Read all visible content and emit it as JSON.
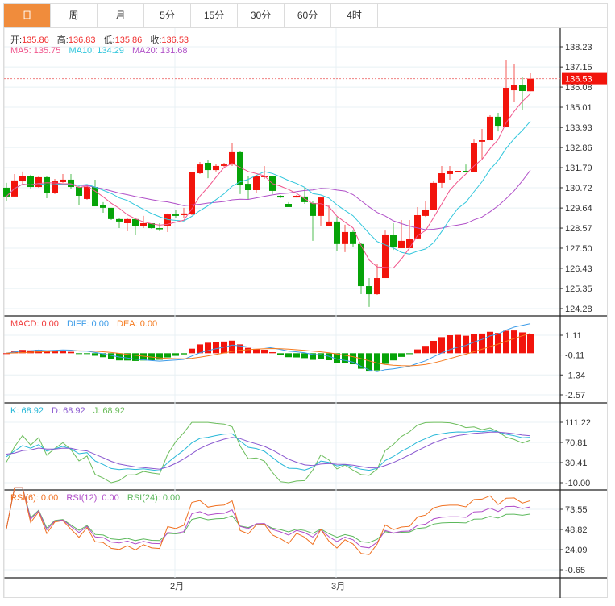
{
  "tabs": [
    {
      "label": "日",
      "active": true
    },
    {
      "label": "周"
    },
    {
      "label": "月"
    },
    {
      "label": "5分"
    },
    {
      "label": "15分"
    },
    {
      "label": "30分"
    },
    {
      "label": "60分"
    },
    {
      "label": "4时"
    }
  ],
  "ohlc_legend": {
    "open_label": "开:",
    "open": "135.86",
    "high_label": "高:",
    "high": "136.83",
    "low_label": "低:",
    "low": "135.86",
    "close_label": "收:",
    "close": "136.53"
  },
  "ma_legend": {
    "ma5": "MA5: 135.75",
    "ma10": "MA10: 134.29",
    "ma20": "MA20: 131.68"
  },
  "macd_legend": {
    "macd": "MACD: 0.00",
    "diff": "DIFF: 0.00",
    "dea": "DEA: 0.00"
  },
  "kdj_legend": {
    "k": "K: 68.92",
    "d": "D: 68.92",
    "j": "J: 68.92"
  },
  "rsi_legend": {
    "rsi6": "RSI(6): 0.00",
    "rsi12": "RSI(12): 0.00",
    "rsi24": "RSI(24): 0.00"
  },
  "last_price": "136.53",
  "colors": {
    "up": "#f2140c",
    "down": "#06a308",
    "ma5": "#f0558c",
    "ma10": "#30c6dc",
    "ma20": "#b050c8",
    "diff": "#3d9ce8",
    "dea": "#f57a1e",
    "k": "#28b8d8",
    "d": "#8a58d0",
    "j": "#6cbd5c",
    "rsi6": "#f07020",
    "rsi12": "#b04cc8",
    "rsi24": "#5cb85c",
    "accent": "#f08c3c"
  },
  "axes": {
    "price_ticks": [
      "138.23",
      "137.15",
      "136.08",
      "135.01",
      "133.93",
      "132.86",
      "131.79",
      "130.72",
      "129.64",
      "128.57",
      "127.50",
      "126.43",
      "125.35",
      "124.28"
    ],
    "macd_ticks": [
      "1.11",
      "-0.11",
      "-1.34",
      "-2.57"
    ],
    "kdj_ticks": [
      "111.22",
      "70.81",
      "30.41",
      "-10.00"
    ],
    "rsi_ticks": [
      "73.55",
      "48.82",
      "24.09",
      "-0.65"
    ],
    "date_labels": [
      {
        "label": "2月",
        "index": 21
      },
      {
        "label": "3月",
        "index": 41
      }
    ]
  },
  "chart_data": {
    "type": "candlestick",
    "ylim": [
      124.28,
      138.23
    ],
    "candles": [
      [
        130.72,
        130.25,
        130.98,
        129.99
      ],
      [
        130.25,
        131.11,
        131.45,
        130.25
      ],
      [
        131.06,
        131.36,
        131.58,
        130.85
      ],
      [
        131.36,
        130.76,
        131.41,
        130.68
      ],
      [
        130.76,
        131.28,
        131.32,
        130.72
      ],
      [
        131.28,
        130.42,
        131.36,
        130.16
      ],
      [
        130.42,
        131.06,
        131.19,
        130.38
      ],
      [
        131.02,
        131.15,
        131.45,
        130.98
      ],
      [
        131.15,
        130.76,
        131.45,
        130.63
      ],
      [
        130.76,
        130.29,
        130.81,
        129.78
      ],
      [
        130.12,
        130.76,
        130.85,
        130.08
      ],
      [
        130.76,
        129.73,
        131.15,
        129.73
      ],
      [
        129.78,
        129.65,
        129.95,
        129.39
      ],
      [
        129.65,
        129.05,
        129.65,
        129.0
      ],
      [
        129.05,
        128.92,
        129.13,
        128.57
      ],
      [
        128.83,
        129.05,
        129.13,
        128.4
      ],
      [
        129.05,
        128.66,
        129.13,
        128.23
      ],
      [
        128.66,
        128.83,
        129.22,
        128.57
      ],
      [
        128.83,
        128.57,
        128.83,
        128.53
      ],
      [
        128.57,
        128.53,
        128.83,
        128.4
      ],
      [
        128.7,
        129.3,
        129.35,
        128.36
      ],
      [
        129.3,
        129.22,
        129.52,
        129.13
      ],
      [
        129.26,
        129.35,
        129.65,
        129.13
      ],
      [
        129.3,
        131.54,
        131.54,
        129.26
      ],
      [
        131.49,
        131.96,
        132.09,
        131.45
      ],
      [
        132.05,
        131.66,
        132.22,
        131.23
      ],
      [
        131.66,
        131.88,
        132.0,
        131.58
      ],
      [
        131.88,
        131.96,
        132.05,
        131.84
      ],
      [
        131.96,
        132.61,
        133.12,
        131.88
      ],
      [
        132.61,
        130.89,
        132.65,
        130.38
      ],
      [
        130.93,
        130.59,
        131.36,
        130.08
      ],
      [
        130.59,
        131.32,
        131.41,
        130.42
      ],
      [
        131.28,
        131.36,
        131.88,
        131.19
      ],
      [
        131.36,
        130.55,
        131.36,
        130.38
      ],
      [
        130.29,
        130.2,
        130.33,
        130.16
      ],
      [
        129.86,
        129.69,
        129.95,
        129.69
      ],
      [
        130.2,
        130.29,
        130.33,
        130.2
      ],
      [
        130.25,
        129.95,
        130.72,
        129.86
      ],
      [
        129.9,
        129.22,
        129.99,
        127.89
      ],
      [
        129.22,
        130.2,
        130.2,
        128.7
      ],
      [
        128.7,
        128.92,
        129.78,
        128.66
      ],
      [
        128.92,
        127.72,
        129.17,
        127.33
      ],
      [
        127.72,
        128.36,
        128.75,
        127.29
      ],
      [
        128.36,
        127.72,
        128.44,
        127.54
      ],
      [
        127.72,
        125.48,
        127.8,
        125.05
      ],
      [
        125.48,
        125.05,
        125.91,
        124.37
      ],
      [
        125.05,
        125.91,
        126.68,
        125.01
      ],
      [
        125.91,
        128.23,
        128.44,
        125.91
      ],
      [
        128.19,
        127.54,
        128.83,
        127.41
      ],
      [
        127.5,
        127.89,
        129.0,
        127.5
      ],
      [
        127.5,
        127.97,
        129.0,
        127.5
      ],
      [
        128.02,
        129.26,
        129.69,
        127.97
      ],
      [
        129.22,
        129.56,
        129.99,
        129.17
      ],
      [
        129.52,
        130.98,
        131.06,
        129.52
      ],
      [
        130.98,
        131.49,
        131.88,
        130.72
      ],
      [
        131.45,
        131.62,
        131.88,
        131.15
      ],
      [
        131.58,
        131.62,
        131.62,
        131.58
      ],
      [
        131.62,
        131.54,
        131.96,
        131.54
      ],
      [
        131.54,
        133.12,
        133.29,
        131.54
      ],
      [
        133.17,
        133.25,
        133.85,
        132.26
      ],
      [
        133.25,
        134.5,
        134.58,
        133.25
      ],
      [
        134.5,
        134.02,
        134.71,
        133.72
      ],
      [
        133.98,
        136.04,
        137.54,
        133.98
      ],
      [
        135.91,
        136.17,
        137.29,
        135.27
      ],
      [
        136.17,
        135.87,
        136.64,
        134.84
      ],
      [
        135.86,
        136.53,
        136.83,
        135.86
      ]
    ]
  }
}
